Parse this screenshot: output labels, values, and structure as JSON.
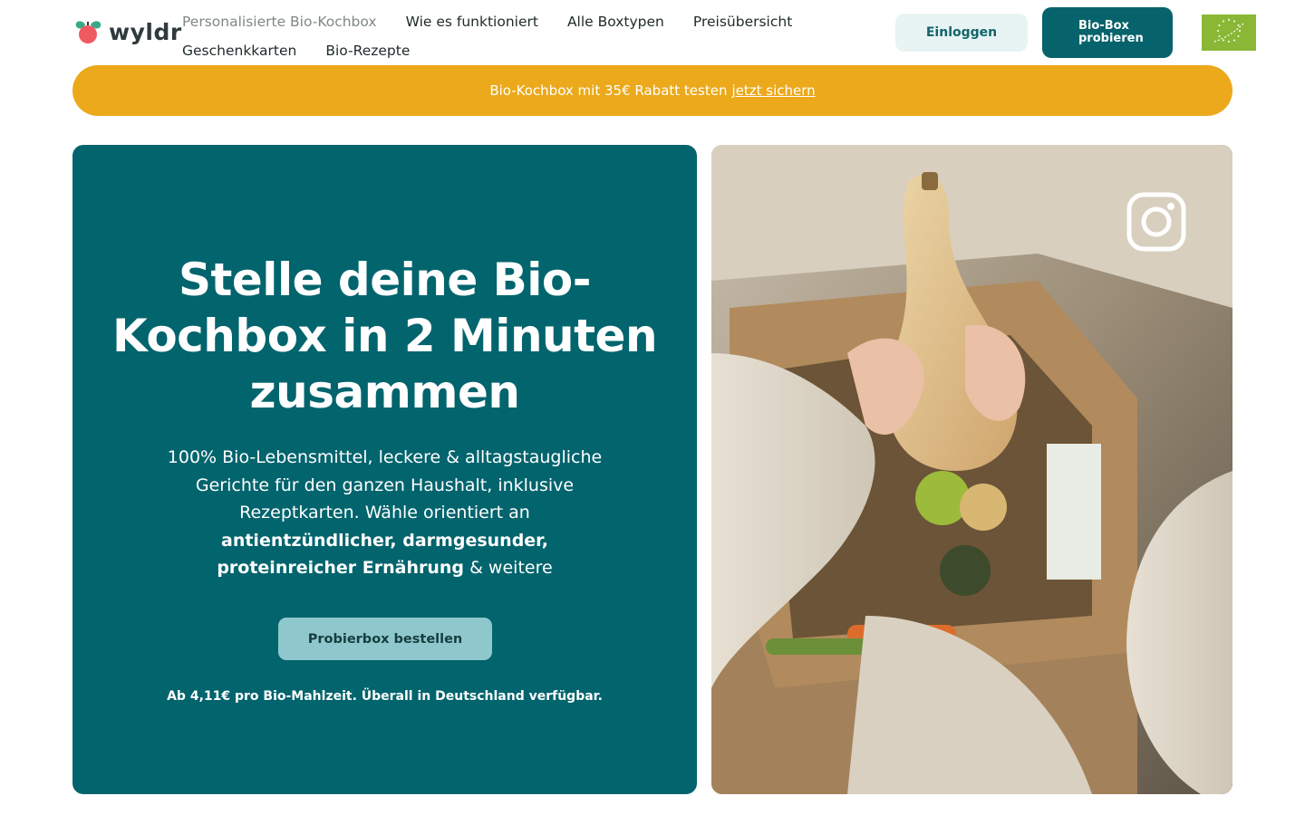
{
  "header": {
    "logo_text": "wyldr",
    "nav_row1": [
      "Personalisierte Bio-Kochbox",
      "Wie es funktioniert",
      "Alle Boxtypen",
      "Preisübersicht"
    ],
    "nav_row2": [
      "Geschenkkarten",
      "Bio-Rezepte"
    ],
    "login_label": "Einloggen",
    "try_label_line1": "Bio-Box",
    "try_label_line2": "probieren"
  },
  "promo": {
    "text": "Bio-Kochbox mit 35€ Rabatt testen",
    "link": "jetzt sichern"
  },
  "hero": {
    "title": "Stelle deine Bio-Kochbox in 2 Minuten zusammen",
    "body_plain_1": "100% Bio-Lebensmittel, leckere & alltagstaugliche Gerichte für den ganzen Haushalt, inklusive Rezeptkarten. Wähle orientiert an",
    "body_bold": "antientzündlicher, darmgesunder, proteinreicher Ernährung",
    "body_plain_2": "& weitere",
    "cta_label": "Probierbox bestellen",
    "note": "Ab 4,11€ pro Bio-Mahlzeit. Überall in Deutschland verfügbar."
  },
  "colors": {
    "brand_teal": "#02646d",
    "promo_yellow": "#eba91b",
    "cta_light_teal": "#8ec8cd",
    "eu_green": "#8ab836"
  },
  "icons": [
    "logo-leaf-icon",
    "eu-organic-logo",
    "instagram-icon"
  ]
}
